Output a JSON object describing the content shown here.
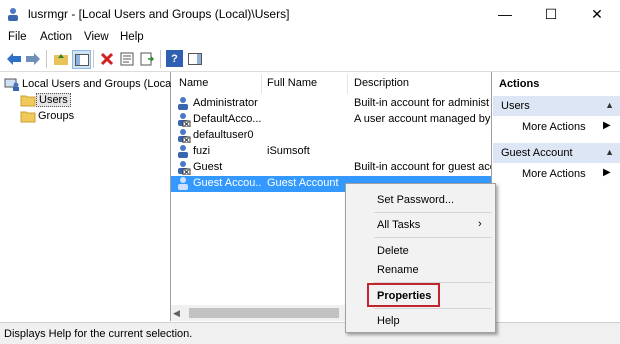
{
  "window": {
    "title": "lusrmgr - [Local Users and Groups (Local)\\Users]",
    "minimize": "—",
    "maximize": "☐",
    "close": "✕"
  },
  "menu": [
    "File",
    "Action",
    "View",
    "Help"
  ],
  "tree": {
    "root": "Local Users and Groups (Local)",
    "items": [
      "Users",
      "Groups"
    ]
  },
  "list": {
    "columns": [
      "Name",
      "Full Name",
      "Description"
    ],
    "rows": [
      {
        "name": "Administrator",
        "full_name": "",
        "description": "Built-in account for administ"
      },
      {
        "name": "DefaultAcco...",
        "full_name": "",
        "description": "A user account managed by t"
      },
      {
        "name": "defaultuser0",
        "full_name": "",
        "description": ""
      },
      {
        "name": "fuzi",
        "full_name": "iSumsoft",
        "description": ""
      },
      {
        "name": "Guest",
        "full_name": "",
        "description": "Built-in account for guest acc"
      },
      {
        "name": "Guest Accou...",
        "full_name": "Guest Account",
        "description": ""
      }
    ],
    "selected_index": 5
  },
  "actions": {
    "header": "Actions",
    "sections": [
      {
        "title": "Users",
        "item": "More Actions"
      },
      {
        "title": "Guest Account",
        "item": "More Actions"
      }
    ]
  },
  "context_menu": {
    "items": [
      "Set Password...",
      "All Tasks",
      "Delete",
      "Rename",
      "Properties",
      "Help"
    ],
    "highlighted": "Properties"
  },
  "status": "Displays Help for the current selection.",
  "colors": {
    "selection": "#3399ff",
    "highlight_box": "#c0262d",
    "actions_subheader": "#dde6f4"
  }
}
